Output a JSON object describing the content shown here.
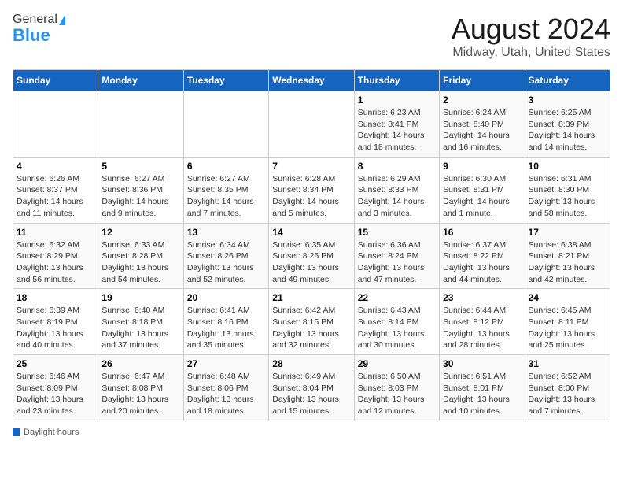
{
  "header": {
    "logo_general": "General",
    "logo_blue": "Blue",
    "main_title": "August 2024",
    "subtitle": "Midway, Utah, United States"
  },
  "calendar": {
    "days_of_week": [
      "Sunday",
      "Monday",
      "Tuesday",
      "Wednesday",
      "Thursday",
      "Friday",
      "Saturday"
    ],
    "weeks": [
      [
        {
          "day": "",
          "info": ""
        },
        {
          "day": "",
          "info": ""
        },
        {
          "day": "",
          "info": ""
        },
        {
          "day": "",
          "info": ""
        },
        {
          "day": "1",
          "info": "Sunrise: 6:23 AM\nSunset: 8:41 PM\nDaylight: 14 hours and 18 minutes."
        },
        {
          "day": "2",
          "info": "Sunrise: 6:24 AM\nSunset: 8:40 PM\nDaylight: 14 hours and 16 minutes."
        },
        {
          "day": "3",
          "info": "Sunrise: 6:25 AM\nSunset: 8:39 PM\nDaylight: 14 hours and 14 minutes."
        }
      ],
      [
        {
          "day": "4",
          "info": "Sunrise: 6:26 AM\nSunset: 8:37 PM\nDaylight: 14 hours and 11 minutes."
        },
        {
          "day": "5",
          "info": "Sunrise: 6:27 AM\nSunset: 8:36 PM\nDaylight: 14 hours and 9 minutes."
        },
        {
          "day": "6",
          "info": "Sunrise: 6:27 AM\nSunset: 8:35 PM\nDaylight: 14 hours and 7 minutes."
        },
        {
          "day": "7",
          "info": "Sunrise: 6:28 AM\nSunset: 8:34 PM\nDaylight: 14 hours and 5 minutes."
        },
        {
          "day": "8",
          "info": "Sunrise: 6:29 AM\nSunset: 8:33 PM\nDaylight: 14 hours and 3 minutes."
        },
        {
          "day": "9",
          "info": "Sunrise: 6:30 AM\nSunset: 8:31 PM\nDaylight: 14 hours and 1 minute."
        },
        {
          "day": "10",
          "info": "Sunrise: 6:31 AM\nSunset: 8:30 PM\nDaylight: 13 hours and 58 minutes."
        }
      ],
      [
        {
          "day": "11",
          "info": "Sunrise: 6:32 AM\nSunset: 8:29 PM\nDaylight: 13 hours and 56 minutes."
        },
        {
          "day": "12",
          "info": "Sunrise: 6:33 AM\nSunset: 8:28 PM\nDaylight: 13 hours and 54 minutes."
        },
        {
          "day": "13",
          "info": "Sunrise: 6:34 AM\nSunset: 8:26 PM\nDaylight: 13 hours and 52 minutes."
        },
        {
          "day": "14",
          "info": "Sunrise: 6:35 AM\nSunset: 8:25 PM\nDaylight: 13 hours and 49 minutes."
        },
        {
          "day": "15",
          "info": "Sunrise: 6:36 AM\nSunset: 8:24 PM\nDaylight: 13 hours and 47 minutes."
        },
        {
          "day": "16",
          "info": "Sunrise: 6:37 AM\nSunset: 8:22 PM\nDaylight: 13 hours and 44 minutes."
        },
        {
          "day": "17",
          "info": "Sunrise: 6:38 AM\nSunset: 8:21 PM\nDaylight: 13 hours and 42 minutes."
        }
      ],
      [
        {
          "day": "18",
          "info": "Sunrise: 6:39 AM\nSunset: 8:19 PM\nDaylight: 13 hours and 40 minutes."
        },
        {
          "day": "19",
          "info": "Sunrise: 6:40 AM\nSunset: 8:18 PM\nDaylight: 13 hours and 37 minutes."
        },
        {
          "day": "20",
          "info": "Sunrise: 6:41 AM\nSunset: 8:16 PM\nDaylight: 13 hours and 35 minutes."
        },
        {
          "day": "21",
          "info": "Sunrise: 6:42 AM\nSunset: 8:15 PM\nDaylight: 13 hours and 32 minutes."
        },
        {
          "day": "22",
          "info": "Sunrise: 6:43 AM\nSunset: 8:14 PM\nDaylight: 13 hours and 30 minutes."
        },
        {
          "day": "23",
          "info": "Sunrise: 6:44 AM\nSunset: 8:12 PM\nDaylight: 13 hours and 28 minutes."
        },
        {
          "day": "24",
          "info": "Sunrise: 6:45 AM\nSunset: 8:11 PM\nDaylight: 13 hours and 25 minutes."
        }
      ],
      [
        {
          "day": "25",
          "info": "Sunrise: 6:46 AM\nSunset: 8:09 PM\nDaylight: 13 hours and 23 minutes."
        },
        {
          "day": "26",
          "info": "Sunrise: 6:47 AM\nSunset: 8:08 PM\nDaylight: 13 hours and 20 minutes."
        },
        {
          "day": "27",
          "info": "Sunrise: 6:48 AM\nSunset: 8:06 PM\nDaylight: 13 hours and 18 minutes."
        },
        {
          "day": "28",
          "info": "Sunrise: 6:49 AM\nSunset: 8:04 PM\nDaylight: 13 hours and 15 minutes."
        },
        {
          "day": "29",
          "info": "Sunrise: 6:50 AM\nSunset: 8:03 PM\nDaylight: 13 hours and 12 minutes."
        },
        {
          "day": "30",
          "info": "Sunrise: 6:51 AM\nSunset: 8:01 PM\nDaylight: 13 hours and 10 minutes."
        },
        {
          "day": "31",
          "info": "Sunrise: 6:52 AM\nSunset: 8:00 PM\nDaylight: 13 hours and 7 minutes."
        }
      ]
    ]
  },
  "footer": {
    "label": "Daylight hours"
  }
}
